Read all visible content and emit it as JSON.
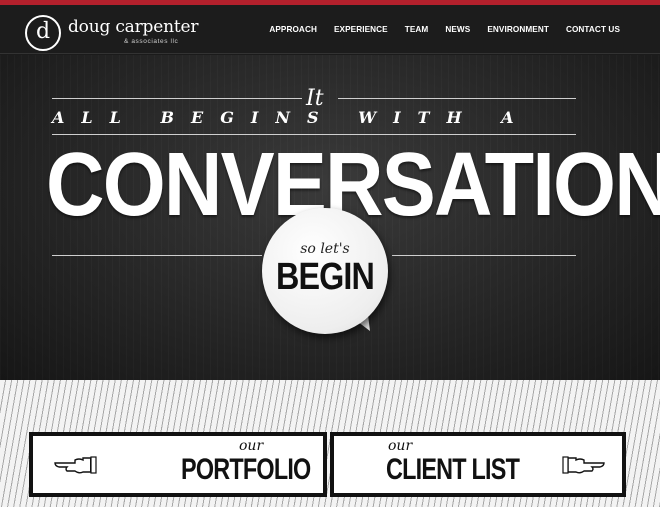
{
  "brand": {
    "monogram": "d",
    "name": "doug carpenter",
    "sub": "& associates llc",
    "accent": "#b3202c"
  },
  "nav": {
    "items": [
      "APPROACH",
      "EXPERIENCE",
      "TEAM",
      "NEWS",
      "ENVIRONMENT",
      "CONTACT US"
    ]
  },
  "hero": {
    "script": "It",
    "tagline": "ALL BEGINS WITH A",
    "headline": "CONVERSATION",
    "bubble_small": "so let's",
    "bubble_big": "BEGIN"
  },
  "links": {
    "portfolio_our": "our",
    "portfolio": "PORTFOLIO",
    "clients_our": "our",
    "clients": "CLIENT LIST"
  },
  "icons": {
    "left_hand": "pointing-hand-left-icon",
    "right_hand": "pointing-hand-right-icon"
  }
}
